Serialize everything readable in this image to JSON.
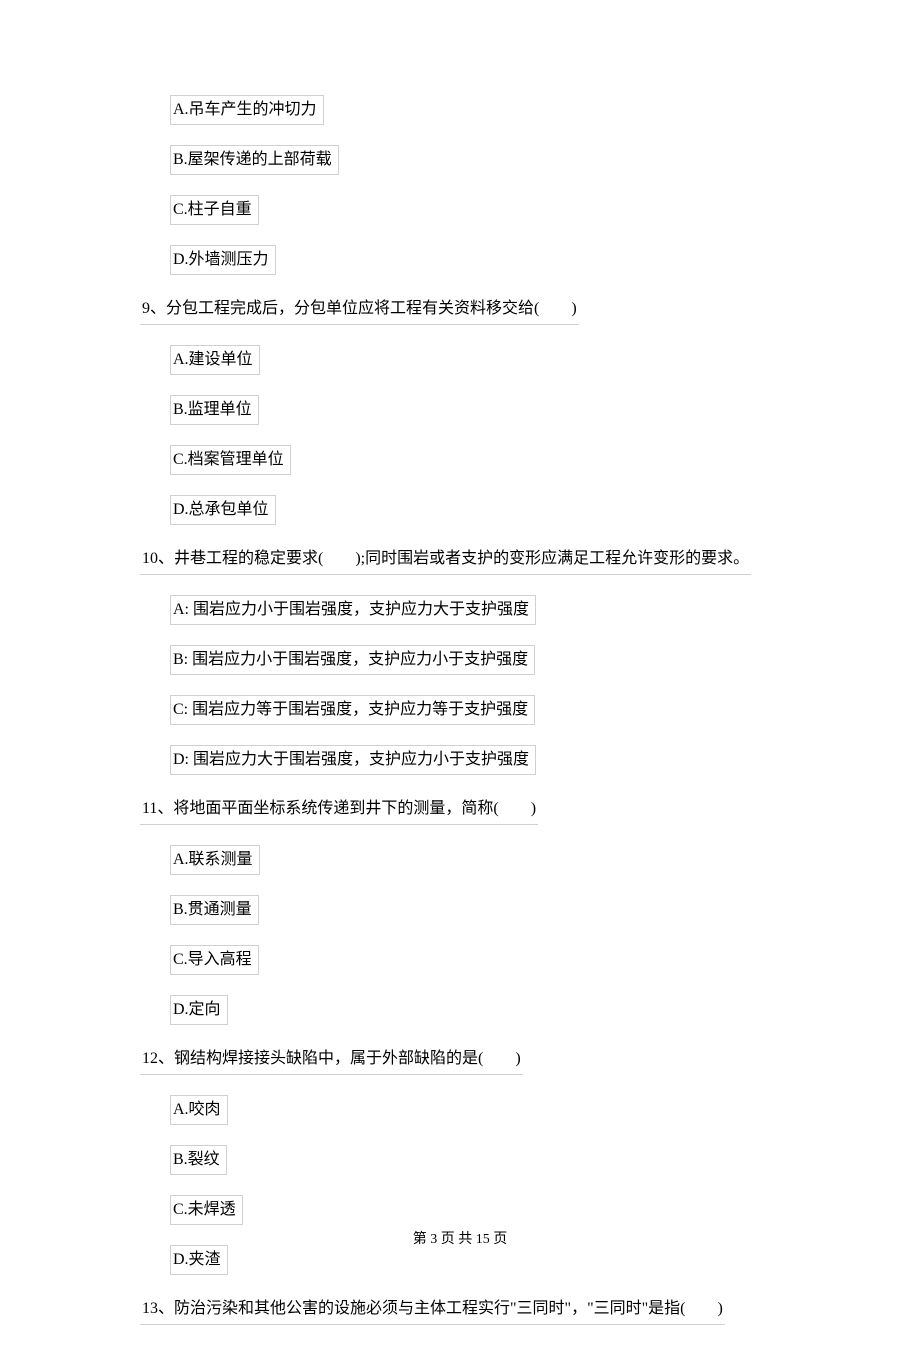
{
  "q8": {
    "options": {
      "a": "A.吊车产生的冲切力",
      "b": "B.屋架传递的上部荷载",
      "c": "C.柱子自重",
      "d": "D.外墙测压力"
    }
  },
  "q9": {
    "text": "9、分包工程完成后，分包单位应将工程有关资料移交给(　　)",
    "options": {
      "a": "A.建设单位",
      "b": "B.监理单位",
      "c": "C.档案管理单位",
      "d": "D.总承包单位"
    }
  },
  "q10": {
    "text": "10、井巷工程的稳定要求(　　);同时围岩或者支护的变形应满足工程允许变形的要求。",
    "options": {
      "a": "A:  围岩应力小于围岩强度，支护应力大于支护强度",
      "b": "B:  围岩应力小于围岩强度，支护应力小于支护强度",
      "c": "C:  围岩应力等于围岩强度，支护应力等于支护强度",
      "d": "D:  围岩应力大于围岩强度，支护应力小于支护强度"
    }
  },
  "q11": {
    "text": "11、将地面平面坐标系统传递到井下的测量，简称(　　)",
    "options": {
      "a": "A.联系测量",
      "b": "B.贯通测量",
      "c": "C.导入高程",
      "d": "D.定向"
    }
  },
  "q12": {
    "text": "12、钢结构焊接接头缺陷中，属于外部缺陷的是(　　)",
    "options": {
      "a": "A.咬肉",
      "b": "B.裂纹",
      "c": "C.未焊透",
      "d": "D.夹渣"
    }
  },
  "q13": {
    "text": "13、防治污染和其他公害的设施必须与主体工程实行\"三同时\"，\"三同时\"是指(　　)"
  },
  "footer": "第 3 页 共 15 页"
}
